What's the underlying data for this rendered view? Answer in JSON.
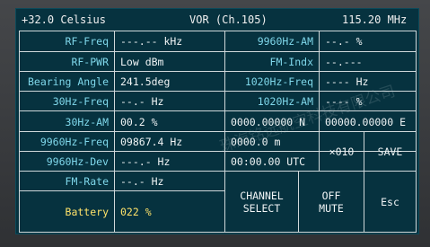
{
  "header": {
    "temperature": "+32.0 Celsius",
    "mode": "VOR (Ch.105)",
    "frequency": "115.20 MHz"
  },
  "rows": [
    {
      "l1": "RF-Freq",
      "v1": "---.-- kHz",
      "l2": "9960Hz-AM",
      "v2": "--.- %"
    },
    {
      "l1": "RF-PWR",
      "v1": "Low  dBm",
      "l2": "FM-Indx",
      "v2": "--.---"
    },
    {
      "l1": "Bearing Angle",
      "v1": "241.5deg",
      "l2": "1020Hz-Freq",
      "v2": "---- Hz"
    },
    {
      "l1": "30Hz-Freq",
      "v1": "--.- Hz",
      "l2": "1020Hz-AM",
      "v2": "---- %"
    },
    {
      "l1": "30Hz-AM",
      "v1": "00.2 %",
      "c3": "0000.00000 N",
      "c4": "00000.00000 E"
    },
    {
      "l1": "9960Hz-Freq",
      "v1": "09867.4 Hz",
      "c3": "0000.0 m"
    },
    {
      "l1": "9960Hz-Dev",
      "v1": "---.- Hz",
      "c3": "00:00.00 UTC"
    },
    {
      "l1": "FM-Rate",
      "v1": "--.- Hz"
    },
    {
      "l1": "Battery",
      "v1": "022 %"
    }
  ],
  "controls": {
    "multiplier": "×010",
    "save": "SAVE",
    "channel_select": "CHANNEL\nSELECT",
    "off_mute": "OFF\nMUTE",
    "esc": "Esc"
  },
  "watermark": "珠海铭远航空科技有限公司",
  "colors": {
    "screen": "#06323f",
    "label": "#7fd7ea",
    "highlight": "#ffe36a"
  }
}
